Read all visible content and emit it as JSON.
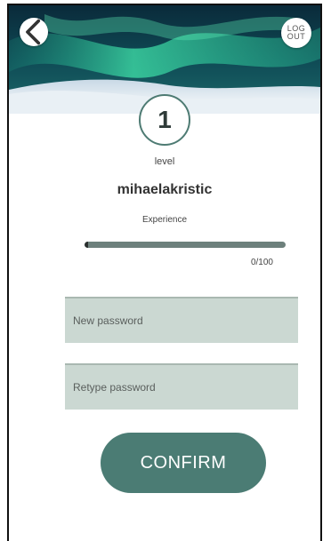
{
  "header": {
    "logout_label": "LOG\nOUT"
  },
  "profile": {
    "level_value": "1",
    "level_label": "level",
    "username": "mihaelakristic",
    "experience_label": "Experience",
    "experience_progress": 0,
    "experience_count": "0/100"
  },
  "form": {
    "new_password_placeholder": "New password",
    "retype_password_placeholder": "Retype password",
    "confirm_label": "CONFIRM"
  },
  "colors": {
    "accent": "#4b7c74",
    "field_bg": "#cbd8d2"
  }
}
